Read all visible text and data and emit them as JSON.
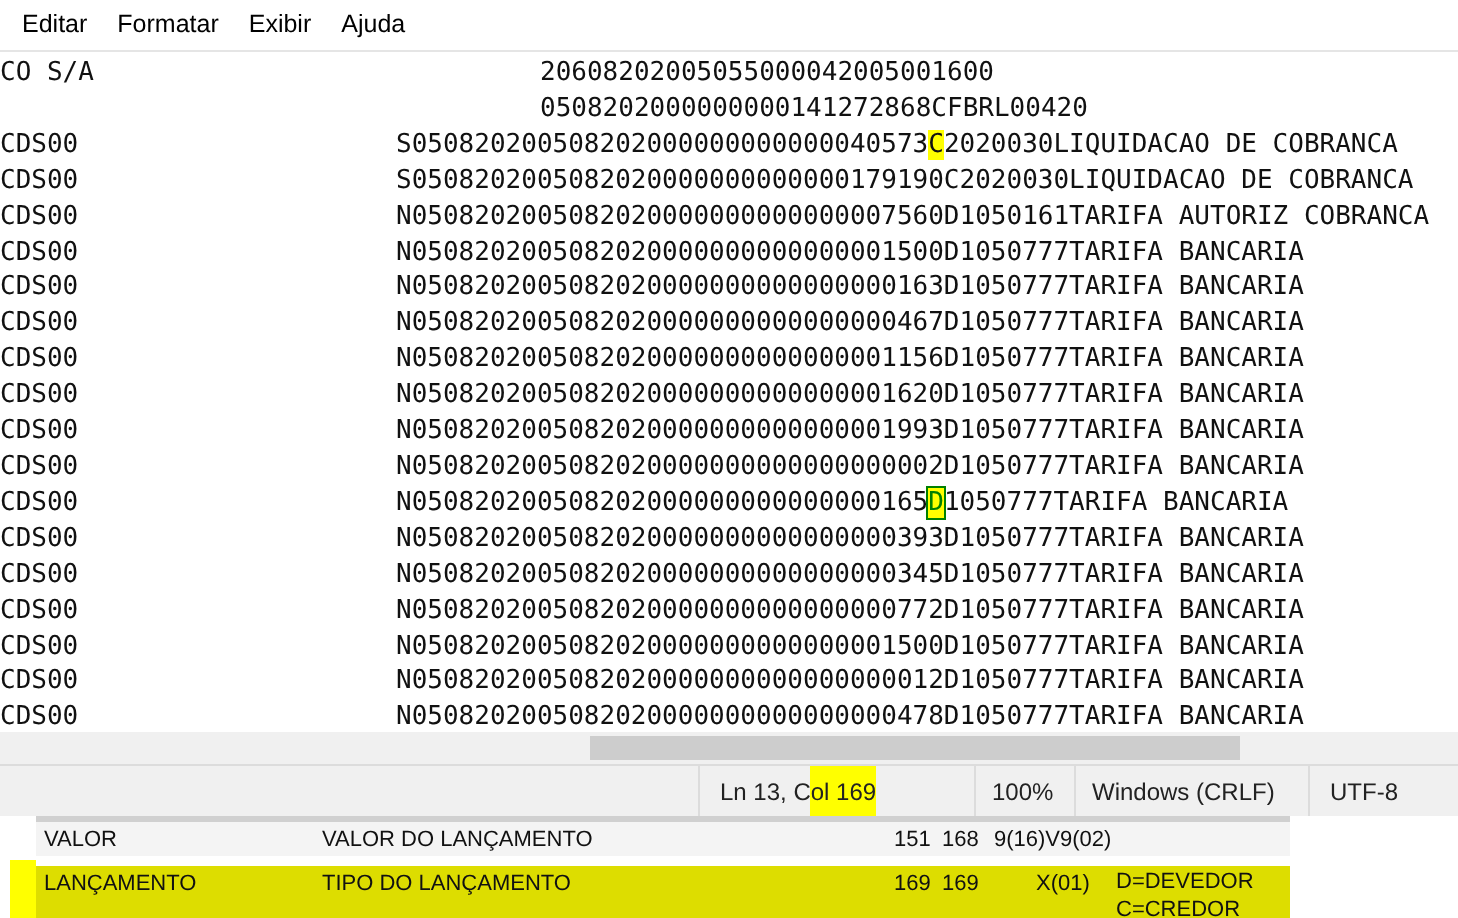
{
  "menu": [
    {
      "label": "Editar"
    },
    {
      "label": "Formatar"
    },
    {
      "label": "Exibir"
    },
    {
      "label": "Ajuda"
    }
  ],
  "lines": [
    {
      "col1": "CO S/A",
      "kind": "header",
      "parts": [
        {
          "text": "20608202005055000042005001600",
          "highlighted": false,
          "caret": false
        }
      ]
    },
    {
      "kind": "header",
      "parts": [
        {
          "text": "0508202000000000141272868CFBRL00420",
          "highlighted": false,
          "caret": false
        }
      ]
    },
    {
      "col1": "CDS00",
      "kind": "record",
      "parts": [
        {
          "text": "S050820200508202000000000000040573",
          "highlighted": false,
          "caret": false
        },
        {
          "text": "C",
          "highlighted": true,
          "caret": false
        },
        {
          "text": "2020030LIQUIDACAO DE COBRANCA",
          "highlighted": false,
          "caret": false
        }
      ]
    },
    {
      "col1": "CDS00",
      "kind": "record",
      "parts": [
        {
          "text": "S0508202005082020000000000000179190C2020030LIQUIDACAO DE COBRANCA",
          "highlighted": false,
          "caret": false
        }
      ]
    },
    {
      "col1": "CDS00",
      "kind": "record",
      "parts": [
        {
          "text": "N0508202005082020000000000000007560D1050161TARIFA AUTORIZ COBRANCA",
          "highlighted": false,
          "caret": false
        }
      ]
    },
    {
      "col1": "CDS00",
      "kind": "record",
      "parts": [
        {
          "text": "N0508202005082020000000000000001500D1050777TARIFA BANCARIA",
          "highlighted": false,
          "caret": false
        }
      ]
    },
    {
      "col1": "CDS00",
      "kind": "record",
      "parts": [
        {
          "text": "N0508202005082020000000000000000163D1050777TARIFA BANCARIA",
          "highlighted": false,
          "caret": false
        }
      ]
    },
    {
      "col1": "CDS00",
      "kind": "record",
      "parts": [
        {
          "text": "N0508202005082020000000000000000467D1050777TARIFA BANCARIA",
          "highlighted": false,
          "caret": false
        }
      ]
    },
    {
      "col1": "CDS00",
      "kind": "record",
      "parts": [
        {
          "text": "N0508202005082020000000000000001156D1050777TARIFA BANCARIA",
          "highlighted": false,
          "caret": false
        }
      ]
    },
    {
      "col1": "CDS00",
      "kind": "record",
      "parts": [
        {
          "text": "N0508202005082020000000000000001620D1050777TARIFA BANCARIA",
          "highlighted": false,
          "caret": false
        }
      ]
    },
    {
      "col1": "CDS00",
      "kind": "record",
      "parts": [
        {
          "text": "N0508202005082020000000000000001993D1050777TARIFA BANCARIA",
          "highlighted": false,
          "caret": false
        }
      ]
    },
    {
      "col1": "CDS00",
      "kind": "record",
      "parts": [
        {
          "text": "N0508202005082020000000000000000002D1050777TARIFA BANCARIA",
          "highlighted": false,
          "caret": false
        }
      ]
    },
    {
      "col1": "CDS00",
      "kind": "record",
      "parts": [
        {
          "text": "N050820200508202000000000000000165",
          "highlighted": false,
          "caret": false
        },
        {
          "text": "D",
          "highlighted": true,
          "caret": true
        },
        {
          "text": "1050777TARIFA BANCARIA",
          "highlighted": false,
          "caret": false
        }
      ]
    },
    {
      "col1": "CDS00",
      "kind": "record",
      "parts": [
        {
          "text": "N0508202005082020000000000000000393D1050777TARIFA BANCARIA",
          "highlighted": false,
          "caret": false
        }
      ]
    },
    {
      "col1": "CDS00",
      "kind": "record",
      "parts": [
        {
          "text": "N0508202005082020000000000000000345D1050777TARIFA BANCARIA",
          "highlighted": false,
          "caret": false
        }
      ]
    },
    {
      "col1": "CDS00",
      "kind": "record",
      "parts": [
        {
          "text": "N0508202005082020000000000000000772D1050777TARIFA BANCARIA",
          "highlighted": false,
          "caret": false
        }
      ]
    },
    {
      "col1": "CDS00",
      "kind": "record",
      "parts": [
        {
          "text": "N0508202005082020000000000000001500D1050777TARIFA BANCARIA",
          "highlighted": false,
          "caret": false
        }
      ]
    },
    {
      "col1": "CDS00",
      "kind": "record",
      "parts": [
        {
          "text": "N0508202005082020000000000000000012D1050777TARIFA BANCARIA",
          "highlighted": false,
          "caret": false
        }
      ]
    },
    {
      "col1": "CDS00",
      "kind": "record",
      "parts": [
        {
          "text": "N0508202005082020000000000000000478D1050777TARIFA BANCARIA",
          "highlighted": false,
          "caret": false
        }
      ]
    }
  ],
  "status_bar": {
    "position": [
      {
        "text": "Ln 13, C",
        "highlighted": false
      },
      {
        "text": "ol 169",
        "highlighted": true
      }
    ],
    "zoom": "100%",
    "line_ending": "Windows (CRLF)",
    "encoding": "UTF-8"
  },
  "layout_table": {
    "rows": [
      {
        "field": "VALOR",
        "description": "VALOR DO LANÇAMENTO",
        "start": "151",
        "end": "168",
        "format": "9(16)V9(02)",
        "highlighted": false
      },
      {
        "field": "LANÇAMENTO",
        "description": "TIPO DO LANÇAMENTO",
        "start": "169",
        "end": "169",
        "format": "X(01)",
        "notes": [
          "D=DEVEDOR",
          "C=CREDOR"
        ],
        "highlighted": true
      }
    ]
  }
}
